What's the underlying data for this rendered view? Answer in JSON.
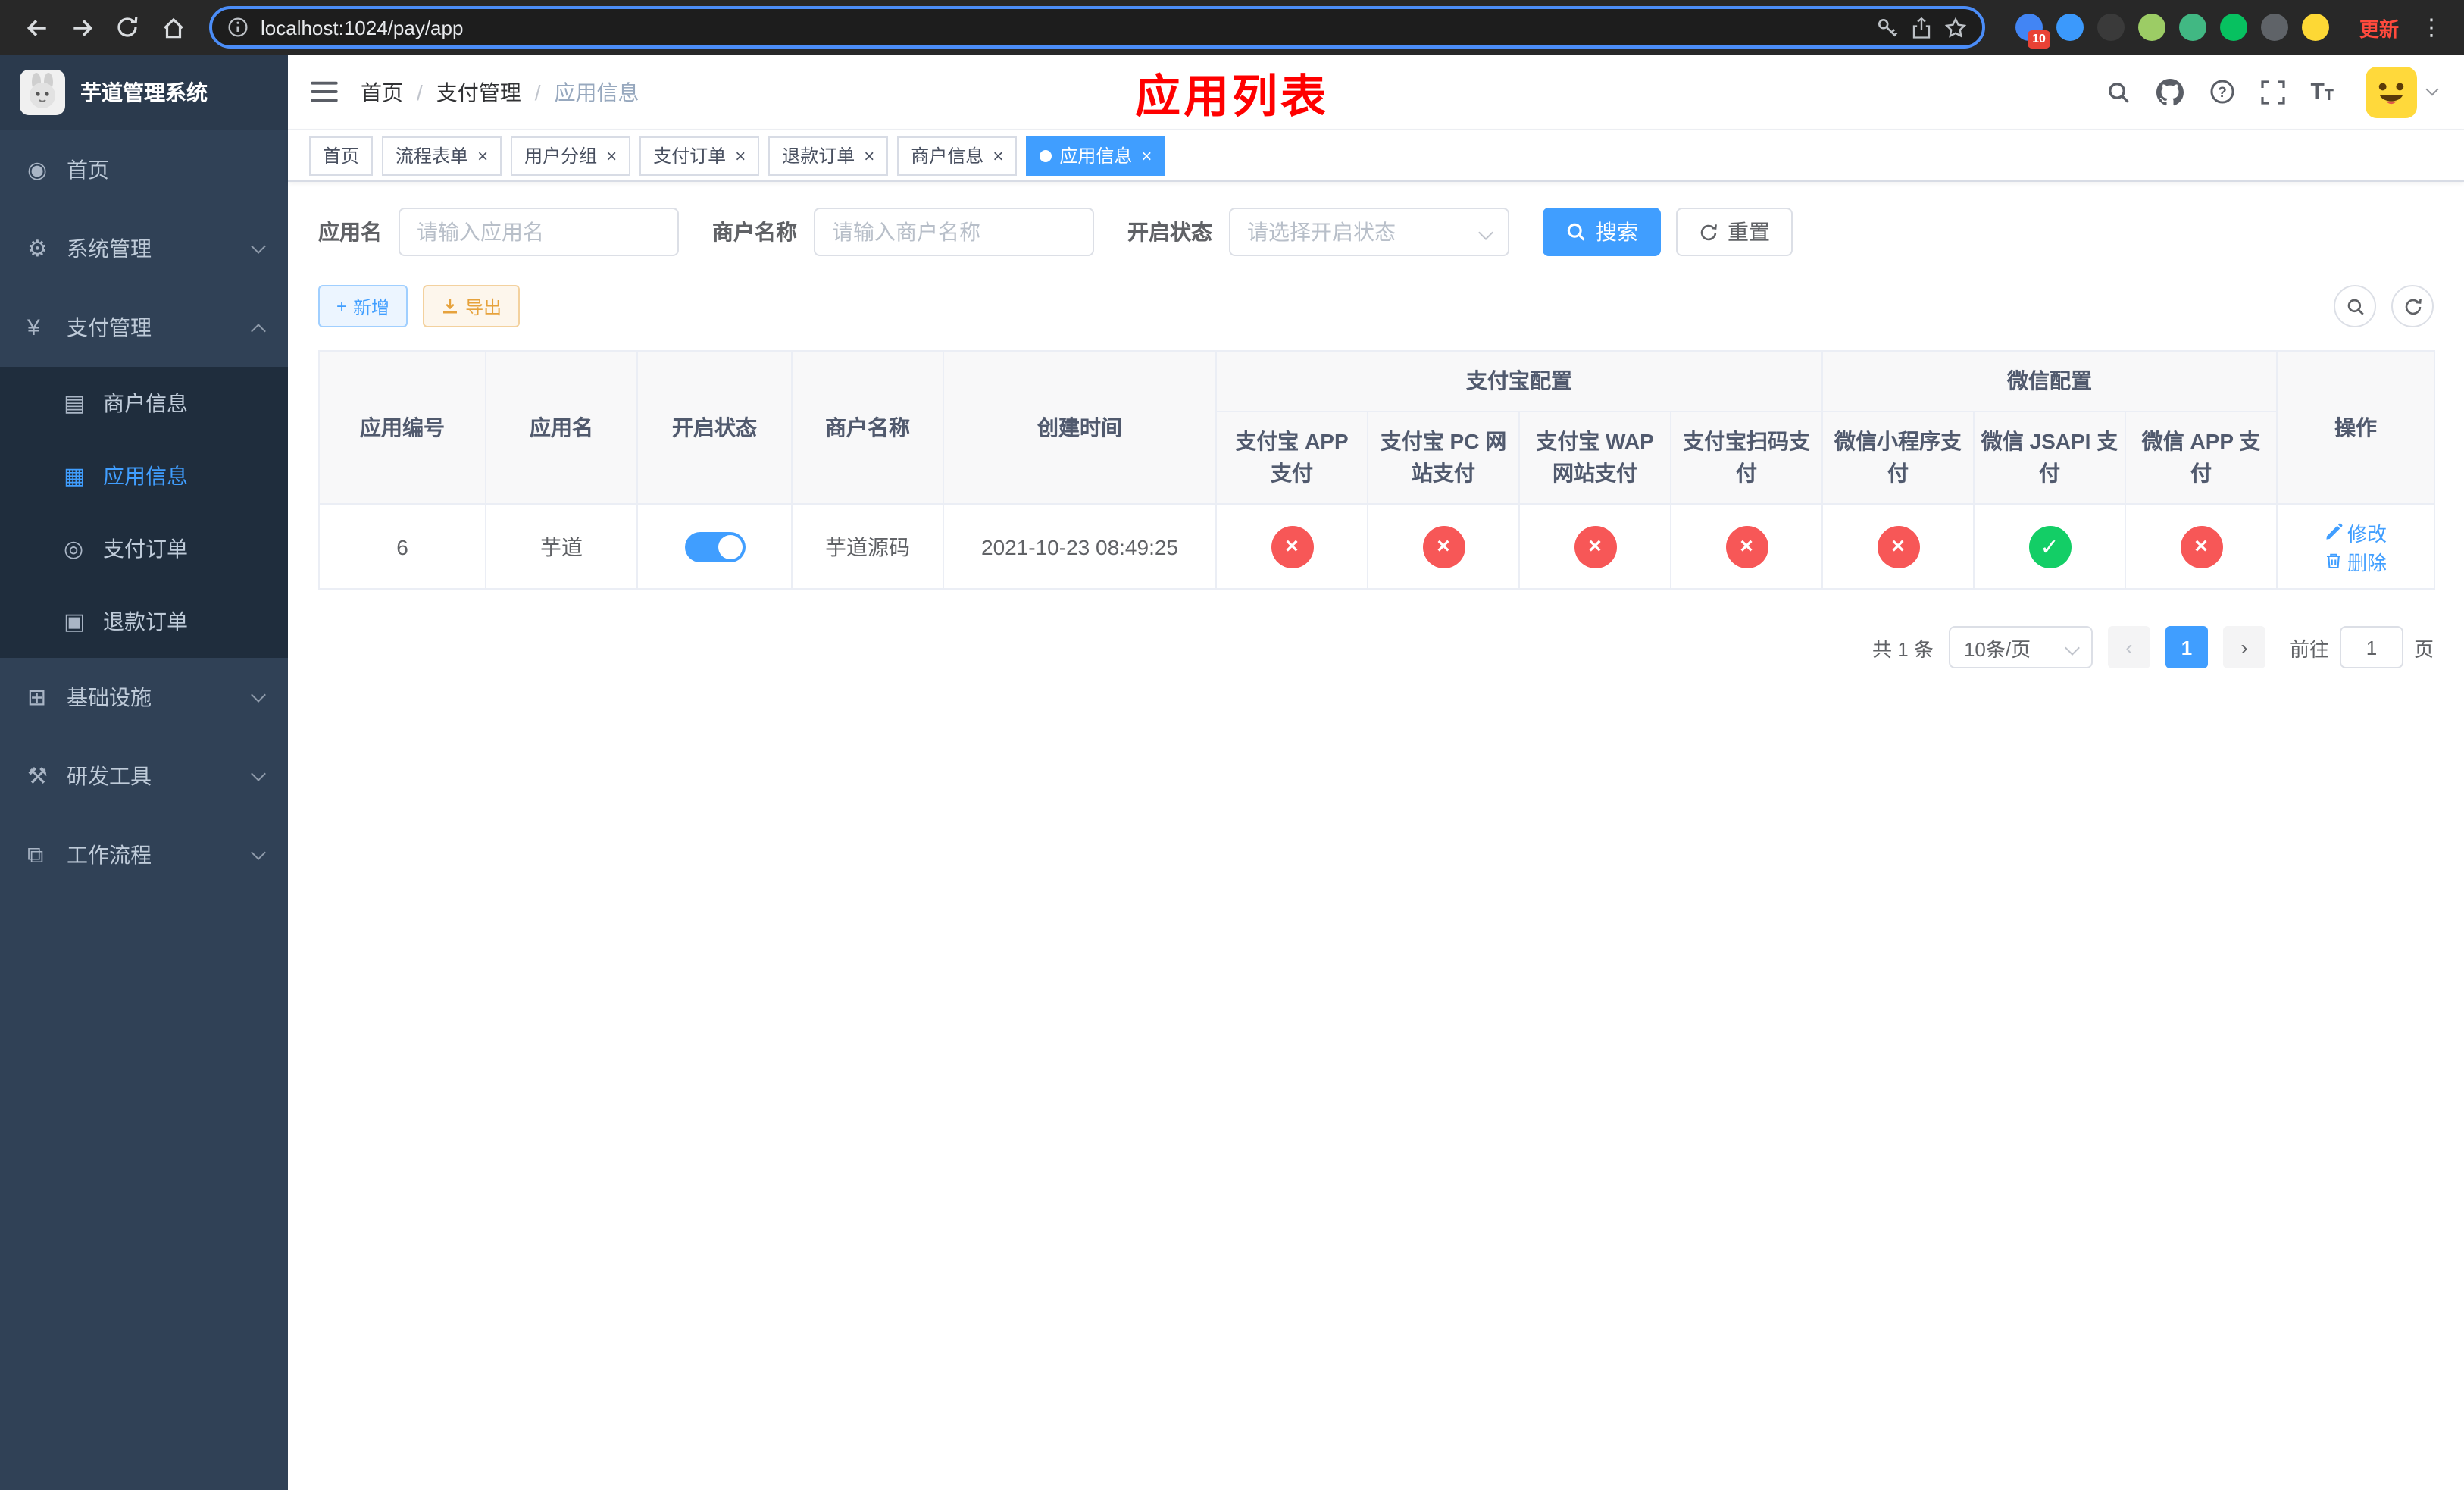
{
  "colors": {
    "primary": "#409EFF",
    "danger": "#f75757",
    "success": "#13ce66",
    "warning": "#e6a23c",
    "annotation": "#ff0000",
    "sidebar-bg": "#304156",
    "submenu-bg": "#1f2d3d"
  },
  "browser": {
    "url": "localhost:1024/pay/app",
    "update_label": "更新",
    "extensions": [
      {
        "name": "extension-stats-icon",
        "color": "#4285f4",
        "badge": "10"
      },
      {
        "name": "extension-drop-icon",
        "color": "#3b99fc"
      },
      {
        "name": "extension-dark-icon",
        "color": "#3a3a3a"
      },
      {
        "name": "extension-avatar-icon",
        "color": "#9ccc65"
      },
      {
        "name": "extension-vue-icon",
        "color": "#41b883"
      },
      {
        "name": "extension-wechat-icon",
        "color": "#07c160"
      },
      {
        "name": "extension-puzzle-icon",
        "color": "#5f6368"
      },
      {
        "name": "extension-emoji-icon",
        "color": "#fdd835"
      }
    ]
  },
  "sidebar": {
    "title": "芋道管理系统",
    "items": [
      {
        "id": "home",
        "label": "首页",
        "icon": "dashboard-icon"
      },
      {
        "id": "system",
        "label": "系统管理",
        "icon": "gear-icon",
        "expandable": true
      },
      {
        "id": "payment",
        "label": "支付管理",
        "icon": "yen-icon",
        "expandable": true,
        "expanded": true,
        "children": [
          {
            "id": "merchant-info",
            "label": "商户信息",
            "icon": "card-icon"
          },
          {
            "id": "app-info",
            "label": "应用信息",
            "icon": "grid-icon",
            "active": true
          },
          {
            "id": "pay-order",
            "label": "支付订单",
            "icon": "order-icon"
          },
          {
            "id": "refund-order",
            "label": "退款订单",
            "icon": "refund-icon"
          }
        ]
      },
      {
        "id": "infra",
        "label": "基础设施",
        "icon": "infra-icon",
        "expandable": true
      },
      {
        "id": "devtools",
        "label": "研发工具",
        "icon": "tools-icon",
        "expandable": true
      },
      {
        "id": "workflow",
        "label": "工作流程",
        "icon": "workflow-icon",
        "expandable": true
      }
    ]
  },
  "header": {
    "breadcrumb": [
      "首页",
      "支付管理",
      "应用信息"
    ],
    "annotation": "应用列表"
  },
  "tabs": [
    {
      "label": "首页",
      "closable": false,
      "active": false
    },
    {
      "label": "流程表单",
      "closable": true,
      "active": false
    },
    {
      "label": "用户分组",
      "closable": true,
      "active": false
    },
    {
      "label": "支付订单",
      "closable": true,
      "active": false
    },
    {
      "label": "退款订单",
      "closable": true,
      "active": false
    },
    {
      "label": "商户信息",
      "closable": true,
      "active": false
    },
    {
      "label": "应用信息",
      "closable": true,
      "active": true
    }
  ],
  "filters": {
    "app_name": {
      "label": "应用名",
      "placeholder": "请输入应用名",
      "value": ""
    },
    "merchant_name": {
      "label": "商户名称",
      "placeholder": "请输入商户名称",
      "value": ""
    },
    "status": {
      "label": "开启状态",
      "placeholder": "请选择开启状态",
      "value": ""
    },
    "search_label": "搜索",
    "reset_label": "重置"
  },
  "toolbar": {
    "add_label": "新增",
    "export_label": "导出"
  },
  "table": {
    "group_alipay": "支付宝配置",
    "group_wechat": "微信配置",
    "columns": [
      "应用编号",
      "应用名",
      "开启状态",
      "商户名称",
      "创建时间",
      "支付宝 APP 支付",
      "支付宝 PC 网站支付",
      "支付宝 WAP 网站支付",
      "支付宝扫码支付",
      "微信小程序支付",
      "微信 JSAPI 支付",
      "微信 APP 支付",
      "操作"
    ],
    "rows": [
      {
        "id": "6",
        "name": "芋道",
        "enabled": true,
        "merchant": "芋道源码",
        "created": "2021-10-23 08:49:25",
        "statuses": {
          "alipay_app": false,
          "alipay_pc": false,
          "alipay_wap": false,
          "alipay_qr": false,
          "wechat_mini": false,
          "wechat_jsapi": true,
          "wechat_app": false
        },
        "edit_label": "修改",
        "delete_label": "删除"
      }
    ]
  },
  "pagination": {
    "total": "共 1 条",
    "page_size": "10条/页",
    "current": "1",
    "goto_label": "前往",
    "goto_value": "1",
    "unit_label": "页"
  }
}
